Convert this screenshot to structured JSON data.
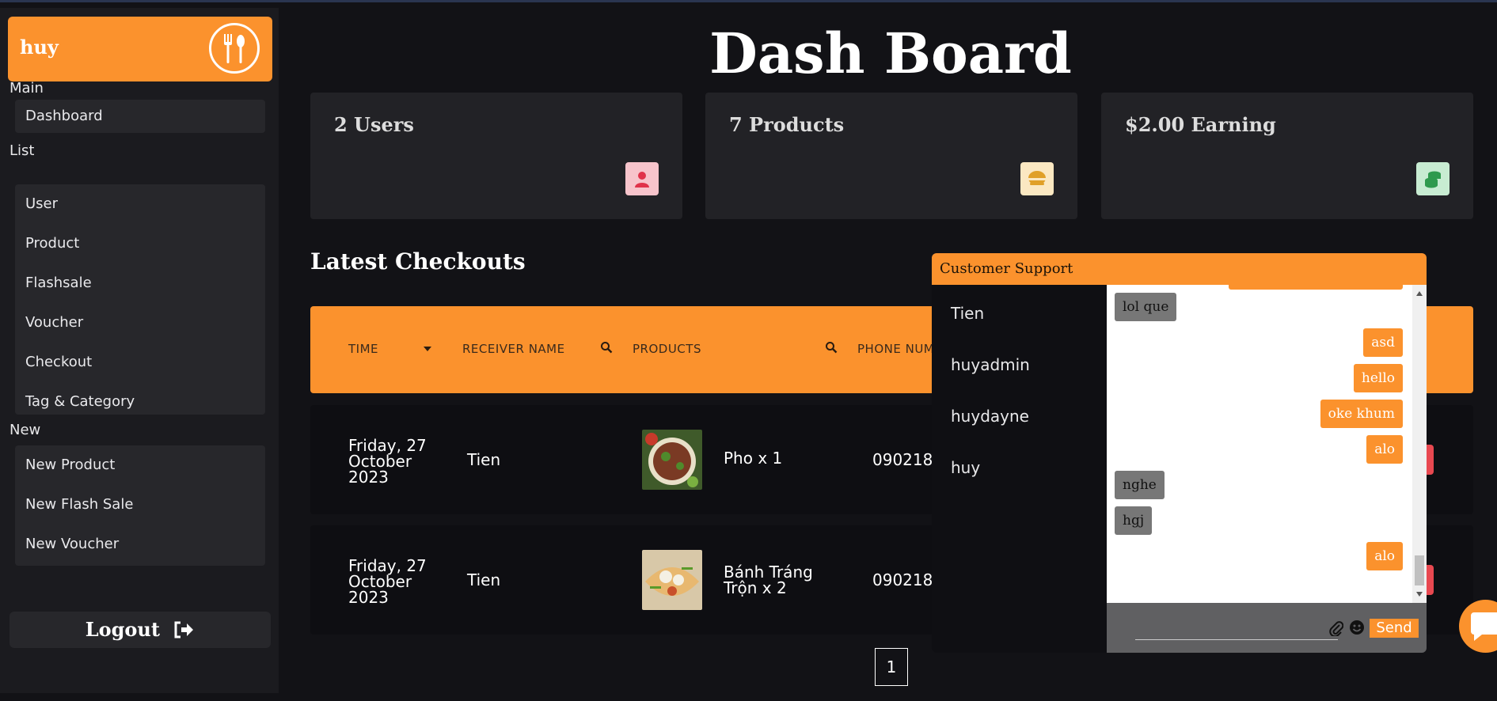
{
  "colors": {
    "accent": "#fb922d",
    "background": "#121216",
    "card": "#222226"
  },
  "sidebar": {
    "brand": "huy",
    "sections": {
      "main": {
        "label": "Main",
        "items": [
          "Dashboard"
        ]
      },
      "list": {
        "label": "List",
        "items": [
          "User",
          "Product",
          "Flashsale",
          "Voucher",
          "Checkout",
          "Tag & Category"
        ]
      },
      "new": {
        "label": "New",
        "items": [
          "New Product",
          "New Flash Sale",
          "New Voucher"
        ]
      }
    },
    "logout": "Logout"
  },
  "page": {
    "title": "Dash Board"
  },
  "stats": [
    {
      "text": "2 Users",
      "icon": "user-icon"
    },
    {
      "text": "7 Products",
      "icon": "food-bowl-icon"
    },
    {
      "text": "$2.00 Earning",
      "icon": "coins-icon"
    }
  ],
  "checkouts": {
    "title": "Latest Checkouts",
    "columns": [
      "TIME",
      "RECEIVER NAME",
      "PRODUCTS",
      "PHONE NUM"
    ],
    "rows": [
      {
        "time": "Friday, 27 October 2023",
        "receiver": "Tien",
        "product": "Pho x 1",
        "phone": "090218"
      },
      {
        "time": "Friday, 27 October 2023",
        "receiver": "Tien",
        "product": "Bánh Tráng Trộn x 2",
        "phone": "090218"
      }
    ],
    "page": "1"
  },
  "chat": {
    "title": "Customer Support",
    "contacts": [
      "Tien",
      "huyadmin",
      "huydayne",
      "huy"
    ],
    "messages": [
      {
        "dir": "in",
        "text": "lol que"
      },
      {
        "dir": "out",
        "text": "asd"
      },
      {
        "dir": "out",
        "text": "hello"
      },
      {
        "dir": "out",
        "text": "oke khum"
      },
      {
        "dir": "out",
        "text": "alo"
      },
      {
        "dir": "in",
        "text": "nghe"
      },
      {
        "dir": "in",
        "text": "hgj"
      },
      {
        "dir": "out",
        "text": "alo"
      }
    ],
    "input_value": "",
    "send_label": "Send"
  }
}
